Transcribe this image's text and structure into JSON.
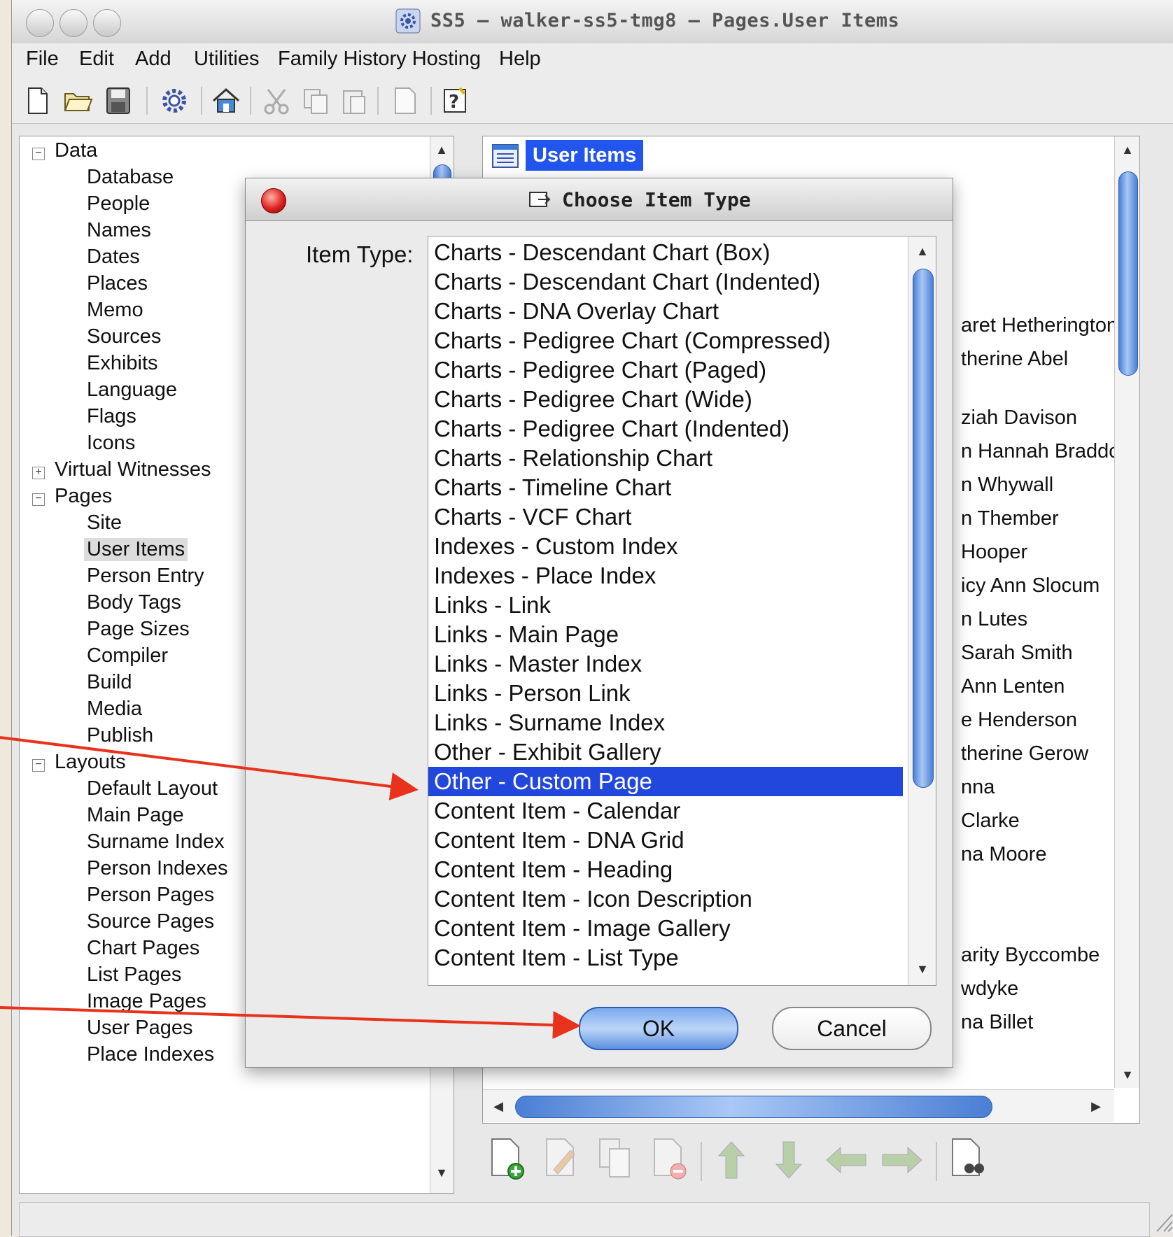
{
  "window": {
    "title": "SS5 – walker-ss5-tmg8 – Pages.User Items"
  },
  "menu": [
    "File",
    "Edit",
    "Add",
    "Utilities",
    "Family History Hosting",
    "Help"
  ],
  "toolbar": {
    "icons": [
      "new-document-icon",
      "open-folder-icon",
      "save-disk-icon",
      "settings-gear-icon",
      "home-icon",
      "cut-scissors-icon",
      "copy-icon",
      "paste-icon",
      "blank-page-icon",
      "help-icon"
    ]
  },
  "tree": {
    "data_label": "Data",
    "data_children": [
      "Database",
      "People",
      "Names",
      "Dates",
      "Places",
      "Memo",
      "Sources",
      "Exhibits",
      "Language",
      "Flags",
      "Icons"
    ],
    "virtual_witnesses": "Virtual Witnesses",
    "pages_label": "Pages",
    "pages_children": [
      "Site",
      "User Items",
      "Person Entry",
      "Body Tags",
      "Page Sizes",
      "Compiler",
      "Build",
      "Media",
      "Publish"
    ],
    "layouts_label": "Layouts",
    "layouts_children": [
      "Default Layout",
      "Main Page",
      "Surname Index",
      "Person Indexes",
      "Person Pages",
      "Source Pages",
      "Chart Pages",
      "List Pages",
      "Image Pages",
      "User Pages",
      "Place Indexes"
    ],
    "selected": "User Items"
  },
  "right_panel": {
    "header": "User Items",
    "partial_items": [
      "aret Hetherington",
      "therine Abel",
      "ziah Davison",
      "n Hannah Braddo",
      "n Whywall",
      "n Thember",
      "Hooper",
      "icy Ann Slocum",
      "n Lutes",
      "Sarah Smith",
      "Ann Lenten",
      "e Henderson",
      "therine Gerow",
      "nna",
      "Clarke",
      "na Moore",
      "arity Byccombe",
      "wdyke",
      "na Billet"
    ]
  },
  "dialog": {
    "title": "Choose Item Type",
    "item_type_label": "Item Type:",
    "items": [
      "Charts - Descendant Chart (Box)",
      "Charts - Descendant Chart (Indented)",
      "Charts - DNA Overlay Chart",
      "Charts - Pedigree Chart (Compressed)",
      "Charts - Pedigree Chart (Paged)",
      "Charts - Pedigree Chart (Wide)",
      "Charts - Pedigree Chart (Indented)",
      "Charts - Relationship Chart",
      "Charts - Timeline Chart",
      "Charts - VCF Chart",
      "Indexes - Custom Index",
      "Indexes - Place Index",
      "Links - Link",
      "Links - Main Page",
      "Links - Master Index",
      "Links - Person Link",
      "Links - Surname Index",
      "Other - Exhibit Gallery",
      "Other - Custom Page",
      "Content Item - Calendar",
      "Content Item - DNA Grid",
      "Content Item - Heading",
      "Content Item - Icon Description",
      "Content Item - Image Gallery",
      "Content Item - List Type"
    ],
    "selected_item": "Other - Custom Page",
    "ok_label": "OK",
    "cancel_label": "Cancel"
  },
  "colors": {
    "selection": "#2247dd",
    "annotation_arrow": "#e8321c"
  }
}
